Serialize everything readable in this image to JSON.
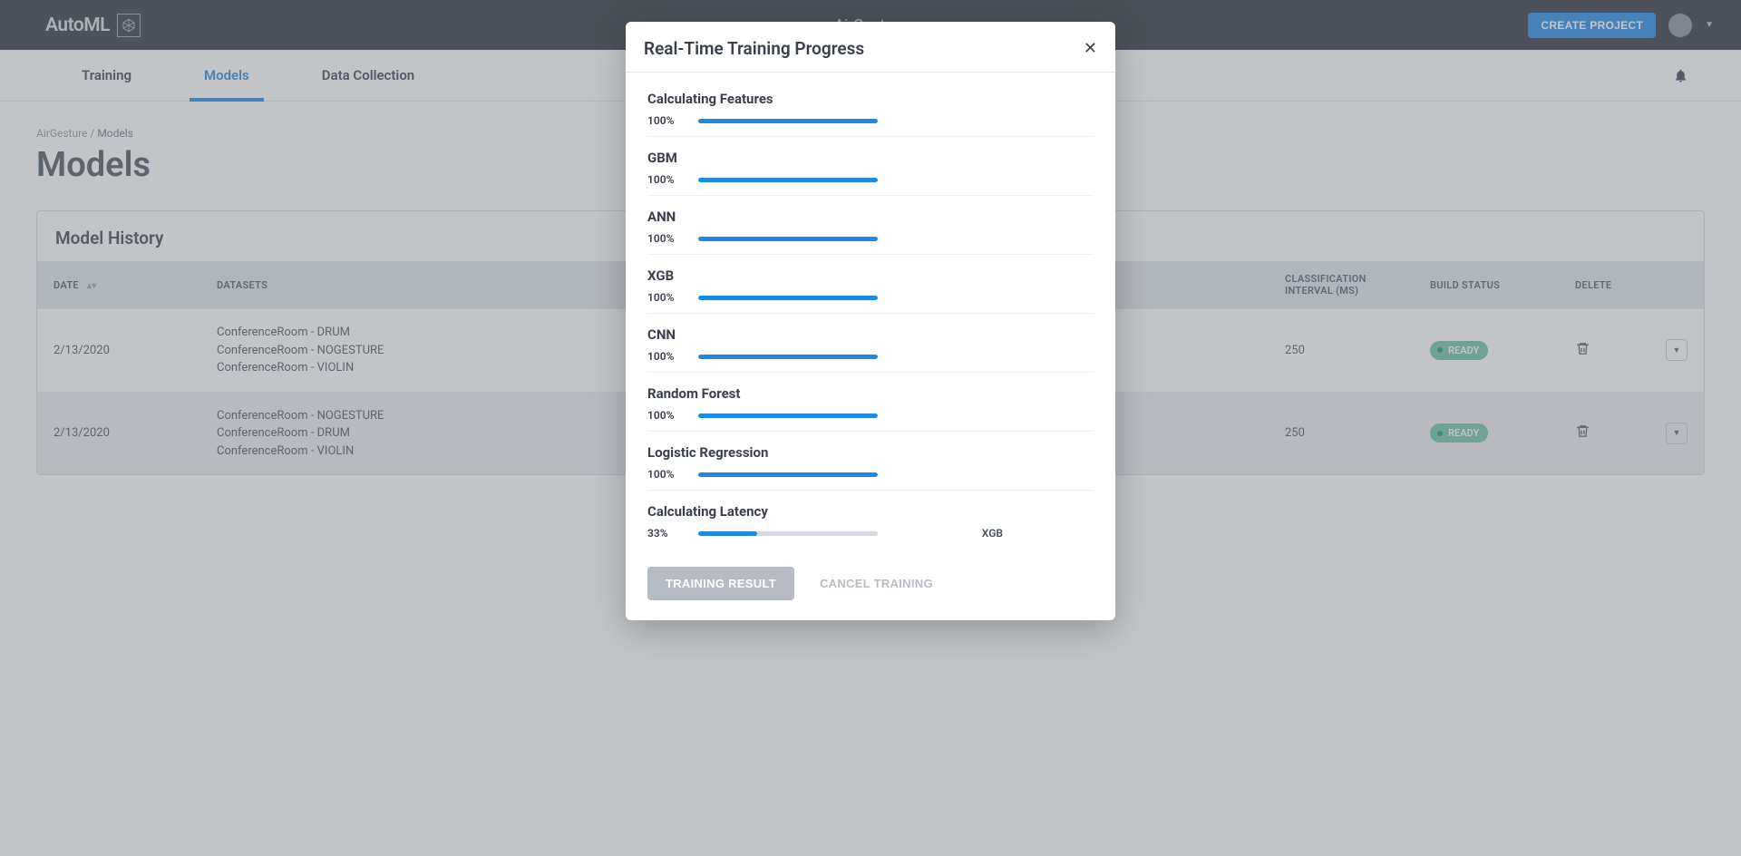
{
  "topbar": {
    "logo": "AutoML",
    "center_title": "AirGesture",
    "create_button": "CREATE PROJECT"
  },
  "nav": {
    "tabs": [
      {
        "label": "Training",
        "active": false
      },
      {
        "label": "Models",
        "active": true
      },
      {
        "label": "Data Collection",
        "active": false
      }
    ]
  },
  "breadcrumb": {
    "parent": "AirGesture",
    "current": "Models"
  },
  "page_title": "Models",
  "card_header": "Model History",
  "table": {
    "headers": {
      "date": "DATE",
      "datasets": "DATASETS",
      "classification_interval": "CLASSIFICATION INTERVAL (MS)",
      "build_status": "BUILD STATUS",
      "delete": "DELETE"
    },
    "rows": [
      {
        "date": "2/13/2020",
        "datasets": [
          "ConferenceRoom - DRUM",
          "ConferenceRoom - NOGESTURE",
          "ConferenceRoom - VIOLIN"
        ],
        "interval": "250",
        "status": "READY"
      },
      {
        "date": "2/13/2020",
        "datasets": [
          "ConferenceRoom - NOGESTURE",
          "ConferenceRoom - DRUM",
          "ConferenceRoom - VIOLIN"
        ],
        "interval": "250",
        "status": "READY"
      }
    ]
  },
  "modal": {
    "title": "Real-Time Training Progress",
    "items": [
      {
        "label": "Calculating Features",
        "pct": "100%",
        "fill": 100,
        "extra": ""
      },
      {
        "label": "GBM",
        "pct": "100%",
        "fill": 100,
        "extra": ""
      },
      {
        "label": "ANN",
        "pct": "100%",
        "fill": 100,
        "extra": ""
      },
      {
        "label": "XGB",
        "pct": "100%",
        "fill": 100,
        "extra": ""
      },
      {
        "label": "CNN",
        "pct": "100%",
        "fill": 100,
        "extra": ""
      },
      {
        "label": "Random Forest",
        "pct": "100%",
        "fill": 100,
        "extra": ""
      },
      {
        "label": "Logistic Regression",
        "pct": "100%",
        "fill": 100,
        "extra": ""
      },
      {
        "label": "Calculating Latency",
        "pct": "33%",
        "fill": 33,
        "extra": "XGB"
      }
    ],
    "result_button": "TRAINING RESULT",
    "cancel_button": "CANCEL TRAINING"
  }
}
